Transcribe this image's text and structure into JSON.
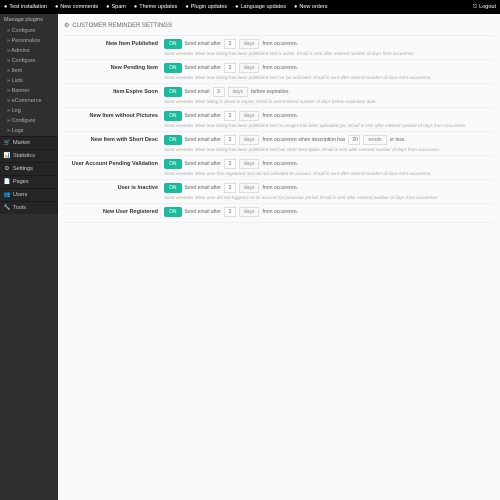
{
  "topbar": {
    "items": [
      "Test installation",
      "New comments",
      "Spam",
      "Theme updates",
      "Plugin updates",
      "Language updates",
      "New orders"
    ],
    "logout": "Logout"
  },
  "sidebar": {
    "header": "Manage plugins",
    "groups": [
      {
        "items": [
          "Configure",
          "Personalize",
          "Admins"
        ]
      },
      {
        "items": [
          "Configure"
        ]
      },
      {
        "items": [
          "Item",
          "Lists",
          "Banner",
          "eCommerce",
          "Log"
        ]
      },
      {
        "items": [
          "Configure",
          "Logs"
        ]
      }
    ],
    "main": [
      {
        "icon": "🛒",
        "label": "Market"
      },
      {
        "icon": "📊",
        "label": "Statistics"
      },
      {
        "icon": "⚙",
        "label": "Settings"
      },
      {
        "icon": "📄",
        "label": "Pages"
      },
      {
        "icon": "👥",
        "label": "Users"
      },
      {
        "icon": "🔧",
        "label": "Tools"
      }
    ]
  },
  "panel": {
    "title": "CUSTOMER REMINDER SETTINGS",
    "rows": [
      {
        "label": "New Item Published",
        "toggle": "ON",
        "pre": "Send email after",
        "val": "3",
        "unit": "days",
        "post": "from occurence.",
        "help": "Send reminder when new listing has been published and is active. Email is sent after entered number of days from occurence."
      },
      {
        "label": "New Pending Item",
        "toggle": "ON",
        "pre": "Send email after",
        "val": "3",
        "unit": "days",
        "post": "from occurence.",
        "help": "Send reminder when new listing has been published and not yet activated. Email is sent after entered number of days from occurence."
      },
      {
        "label": "Item Expire Soon",
        "toggle": "ON",
        "pre": "Send email",
        "val": "3",
        "unit": "days",
        "post": "before expiration.",
        "help": "Send reminder when listing is about to expire. Email is sent entered number of days before expiration date."
      },
      {
        "label": "New Item without Pictures",
        "toggle": "ON",
        "pre": "Send email after",
        "val": "3",
        "unit": "days",
        "post": "from occurence.",
        "help": "Send reminder when new listing has been published and no images has been uploaded yet. Email is sent after entered number of days from occurence."
      },
      {
        "label": "New Item with Short Desc",
        "toggle": "ON",
        "pre": "Send email after",
        "val": "3",
        "unit": "days",
        "post": "from occurence when description has",
        "val2": "20",
        "unit2": "words",
        "post2": "or less.",
        "help": "Send reminder when new listing has been published and has short description. Email is sent after entered number of days from occurence."
      },
      {
        "label": "User Account Pending Validation",
        "toggle": "ON",
        "pre": "Send email after",
        "val": "3",
        "unit": "days",
        "post": "from occurence.",
        "help": "Send reminder when user has registered and did not activated its account. Email is sent after entered number of days from occurence."
      },
      {
        "label": "User is Inactive",
        "toggle": "ON",
        "pre": "Send email after",
        "val": "3",
        "unit": "days",
        "post": "from occurence.",
        "help": "Send reminder when user did not logged in to its account for particular period. Email is sent after entered number of days from occurence."
      },
      {
        "label": "New User Registered",
        "toggle": "ON",
        "pre": "Send email after",
        "val": "3",
        "unit": "days",
        "post": "from occurence.",
        "help": ""
      }
    ]
  }
}
